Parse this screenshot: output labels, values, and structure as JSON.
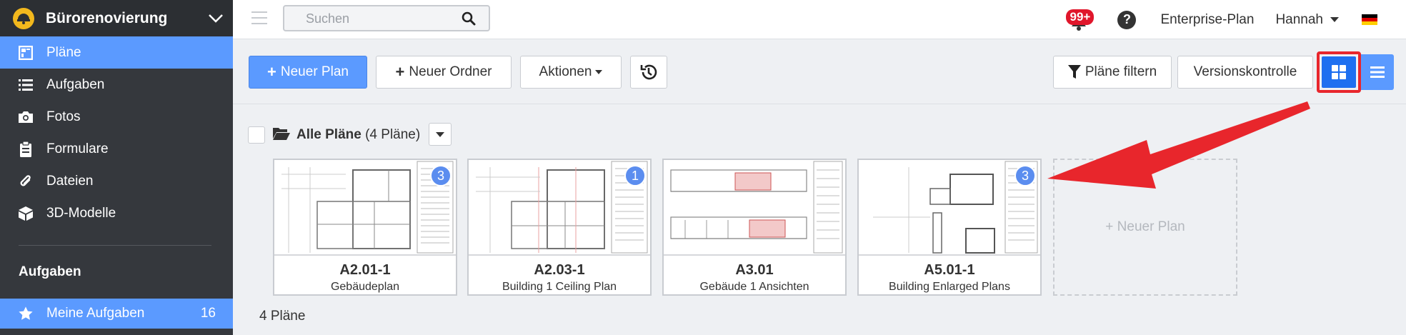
{
  "sidebar": {
    "project_name": "Bürorenovierung",
    "items": [
      {
        "label": "Pläne",
        "icon": "plans-icon"
      },
      {
        "label": "Aufgaben",
        "icon": "list-icon"
      },
      {
        "label": "Fotos",
        "icon": "camera-icon"
      },
      {
        "label": "Formulare",
        "icon": "clipboard-icon"
      },
      {
        "label": "Dateien",
        "icon": "paperclip-icon"
      },
      {
        "label": "3D-Modelle",
        "icon": "cube-icon"
      }
    ],
    "section_title": "Aufgaben",
    "task_item": {
      "label": "Meine Aufgaben",
      "count": "16",
      "icon": "star-icon"
    }
  },
  "topbar": {
    "search_placeholder": "Suchen",
    "notifications_badge": "99+",
    "help_label": "?",
    "plan_link": "Enterprise-Plan",
    "user_name": "Hannah"
  },
  "toolbar": {
    "new_plan": "Neuer Plan",
    "new_folder": "Neuer Ordner",
    "actions": "Aktionen",
    "filter": "Pläne filtern",
    "version_control": "Versionskontrolle"
  },
  "folder": {
    "name": "Alle Pläne",
    "count": "(4 Pläne)"
  },
  "cards": [
    {
      "code": "A2.01-1",
      "title": "Gebäudeplan",
      "badge": "3"
    },
    {
      "code": "A2.03-1",
      "title": "Building 1 Ceiling Plan",
      "badge": "1"
    },
    {
      "code": "A3.01",
      "title": "Gebäude 1 Ansichten",
      "badge": ""
    },
    {
      "code": "A5.01-1",
      "title": "Building Enlarged Plans",
      "badge": "3"
    }
  ],
  "new_plan_card": "+ Neuer Plan",
  "footer_count": "4 Pläne",
  "colors": {
    "accent": "#5b9aff",
    "active_view": "#1e6ff0",
    "highlight": "#e8262c",
    "sidebar_bg": "#35383d"
  }
}
